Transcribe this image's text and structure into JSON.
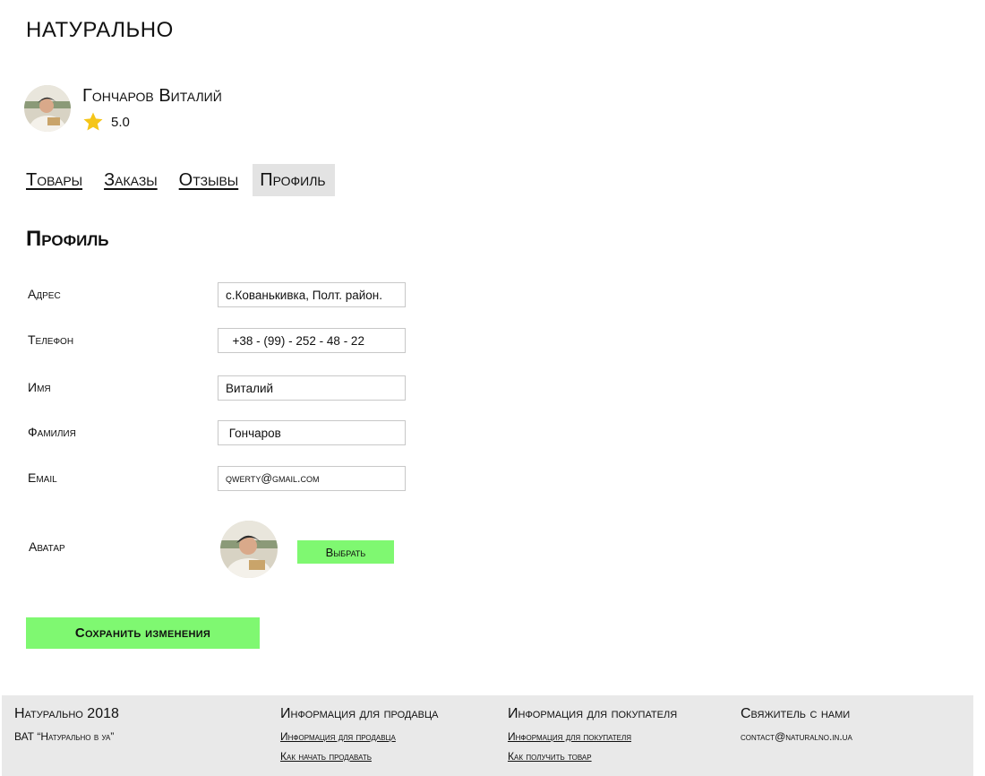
{
  "brand": {
    "logo": "НАТУРАЛЬНО"
  },
  "seller": {
    "name": "Гончаров Виталий",
    "rating": "5.0",
    "rating_color": "#f5c518"
  },
  "tabs": [
    {
      "label": "Товары",
      "active": false
    },
    {
      "label": "Заказы",
      "active": false
    },
    {
      "label": "Отзывы",
      "active": false
    },
    {
      "label": "Профиль",
      "active": true
    }
  ],
  "profile": {
    "title": "Профиль",
    "fields": {
      "address": {
        "label": "Адрес",
        "value": "с.Кованькивка, Полт. район."
      },
      "phone": {
        "label": "Телефон",
        "value": "  +38 - (99) - 252 - 48 - 22"
      },
      "first_name": {
        "label": "Имя",
        "value": "Виталий"
      },
      "last_name": {
        "label": "Фамилия",
        "value": " Гончаров"
      },
      "email": {
        "label": "Email",
        "value": "qwerty@gmail.com"
      }
    },
    "avatar": {
      "label": "Аватар",
      "choose_label": "Выбрать"
    },
    "save_label": "Сохранить изменения",
    "accent_color": "#7ff871"
  },
  "footer": {
    "brand": {
      "title": "Натурально 2018",
      "subtitle": "ВАТ “Натурально в уа”"
    },
    "seller_info": {
      "title": "Информация для продавца",
      "links": [
        "Информация для продавца",
        "Как начать продавать"
      ]
    },
    "buyer_info": {
      "title": "Информация для покупателя",
      "links": [
        "Информация для покупателя",
        "Как получить товар"
      ]
    },
    "contact": {
      "title": "Свяжитель с нами",
      "email": "contact@naturalno.in.ua"
    }
  }
}
